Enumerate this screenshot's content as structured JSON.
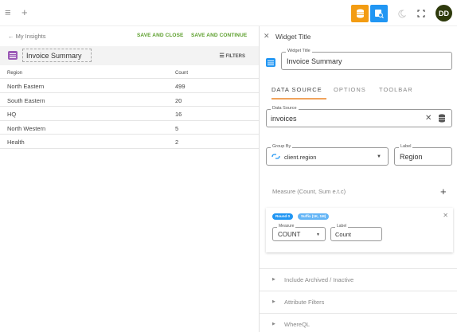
{
  "topbar": {
    "menu_icon": "hamburger-icon",
    "add_icon": "plus-icon",
    "buttons": [
      {
        "icon": "database-icon",
        "color": "#f39c12"
      },
      {
        "icon": "database-search-icon",
        "color": "#2196f3"
      },
      {
        "icon": "moon-icon"
      },
      {
        "icon": "fullscreen-icon"
      }
    ],
    "avatar_initials": "DD"
  },
  "left": {
    "back_label": "← My Insights",
    "save_close_label": "SAVE AND CLOSE",
    "save_continue_label": "SAVE AND CONTINUE",
    "widget_title": "Invoice Summary",
    "filters_label": "FILTERS",
    "table": {
      "headers": [
        "Region",
        "Count"
      ],
      "rows": [
        [
          "North Eastern",
          "499"
        ],
        [
          "South Eastern",
          "20"
        ],
        [
          "HQ",
          "16"
        ],
        [
          "North Western",
          "5"
        ],
        [
          "Health",
          "2"
        ]
      ]
    }
  },
  "right": {
    "close_icon": "close-icon",
    "panel_title": "Widget Title",
    "widget_title_field": {
      "label": "Widget Title",
      "value": "Invoice Summary"
    },
    "tabs": [
      "DATA SOURCE",
      "OPTIONS",
      "TOOLBAR"
    ],
    "data_source": {
      "label": "Data Source",
      "value": "invoices"
    },
    "group_by": {
      "label": "Group By",
      "value": "client.region"
    },
    "group_label": {
      "label": "Label",
      "value": "Region"
    },
    "measure_header": "Measure (Count, Sum e.t.c)",
    "measure": {
      "chips": [
        "Round 0",
        "Suffix (1K, 1M)"
      ],
      "measure_field": {
        "label": "Measure",
        "value": "COUNT"
      },
      "label_field": {
        "label": "Label",
        "value": "Count"
      }
    },
    "sections": [
      "Include Archived / Inactive",
      "Attribute Filters",
      "WhereQL"
    ]
  },
  "colors": {
    "accent_green": "#5a9e2a",
    "accent_orange": "#f39c12",
    "accent_blue": "#2196f3",
    "tab_underline": "#f0a35c"
  }
}
